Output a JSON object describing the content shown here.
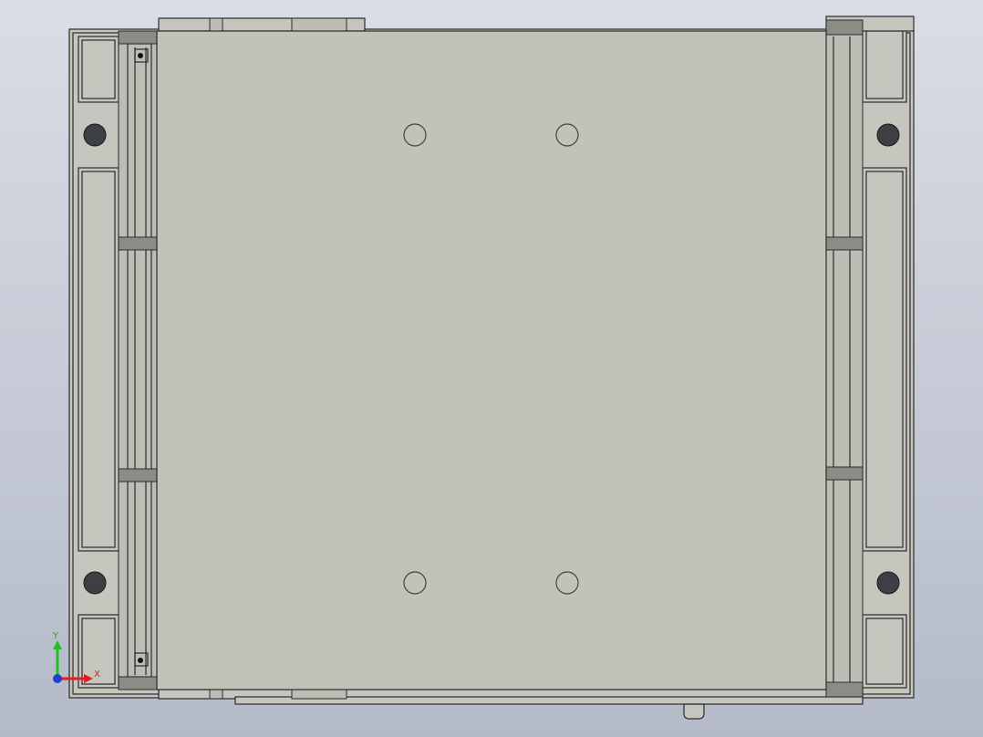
{
  "viewport": {
    "background_top": "#d9dde6",
    "background_bottom": "#b4bac8"
  },
  "triad": {
    "x_label": "X",
    "y_label": "Y",
    "x_color": "#e02020",
    "y_color": "#20c020",
    "origin_color": "#2040d0"
  }
}
